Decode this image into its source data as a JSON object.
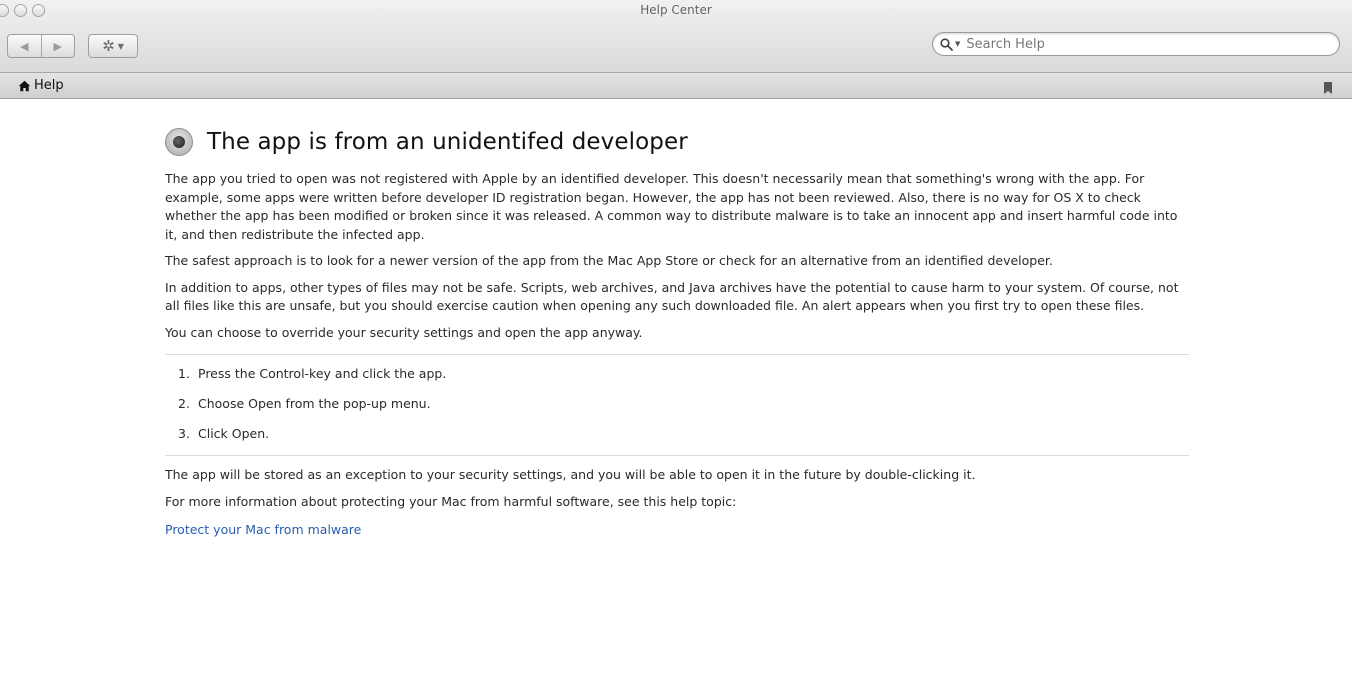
{
  "window": {
    "title": "Help Center"
  },
  "toolbar": {
    "back_icon": "back-arrow-icon",
    "forward_icon": "forward-arrow-icon",
    "action_icon": "gear-icon",
    "search_placeholder": "Search Help",
    "search_value": ""
  },
  "navbar": {
    "home_label": "Help",
    "home_icon": "home-icon",
    "bookmark_icon": "bookmark-icon"
  },
  "article": {
    "title": "The app is from an unidentifed developer",
    "paragraphs": [
      "The app you tried to open was not registered with Apple by an identified developer. This doesn't necessarily mean that something's wrong with the app. For example, some apps were written before developer ID registration began. However, the app has not been reviewed. Also, there is no way for OS X to check whether the app has been modified or broken since it was released. A common way to distribute malware is to take an innocent app and insert harmful code into it, and then redistribute the infected app.",
      "The safest approach is to look for a newer version of the app from the Mac App Store or check for an alternative from an identified developer.",
      "In addition to apps, other types of files may not be safe. Scripts, web archives, and Java archives have the potential to cause harm to your system. Of course, not all files like this are unsafe, but you should exercise caution when opening any such downloaded file. An alert appears when you first try to open these files.",
      "You can choose to override your security settings and open the app anyway."
    ],
    "steps": [
      {
        "num": "1.",
        "text": "Press the Control-key and click the app."
      },
      {
        "num": "2.",
        "text": "Choose Open from the pop-up menu."
      },
      {
        "num": "3.",
        "text": "Click Open."
      }
    ],
    "after_paragraphs": [
      "The app will be stored as an exception to your security settings, and you will be able to open it in the future by double-clicking it.",
      "For more information about protecting your Mac from harmful software, see this help topic:"
    ],
    "link_text": "Protect your Mac from malware"
  },
  "colors": {
    "link": "#2a5db0",
    "toolbar_top": "#f1f1f1",
    "toolbar_bottom": "#dadada"
  }
}
